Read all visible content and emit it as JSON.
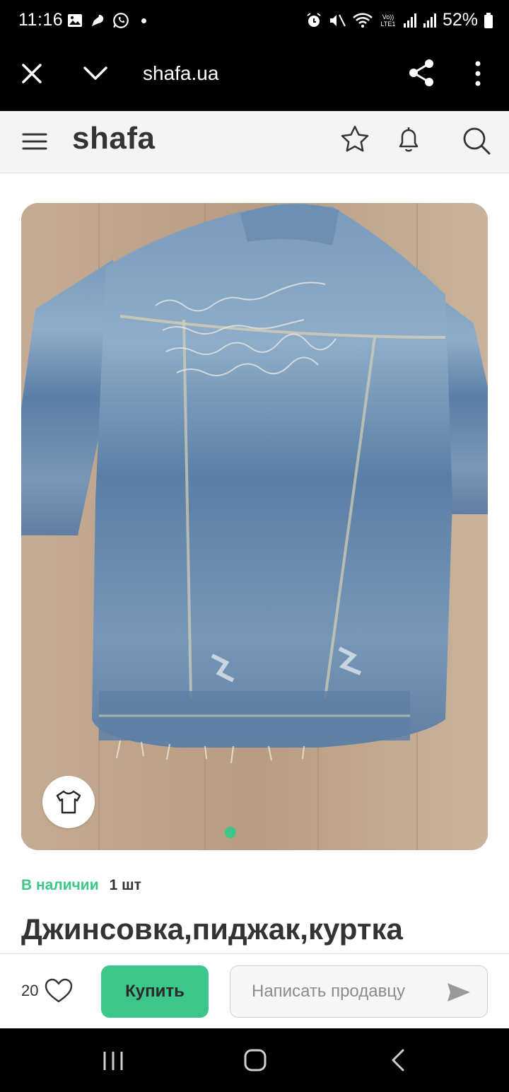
{
  "status_bar": {
    "time": "11:16",
    "battery_percent": "52%",
    "icons_left": [
      "gallery-icon",
      "messenger-icon",
      "whatsapp-icon",
      "notification-dot"
    ],
    "icons_right": [
      "alarm-icon",
      "mute-icon",
      "wifi-icon",
      "volte-icon",
      "signal-icon",
      "signal-icon",
      "battery-icon"
    ],
    "volte_label": "Vo)) LTE1"
  },
  "browser": {
    "url": "shafa.ua",
    "close_icon": "close-icon",
    "collapse_icon": "chevron-down-icon",
    "share_icon": "share-icon",
    "menu_icon": "more-vertical-icon"
  },
  "site_header": {
    "logo": "shafa",
    "icons": [
      "menu-icon",
      "star-icon",
      "bell-icon",
      "search-icon"
    ]
  },
  "gallery": {
    "image_count": 1,
    "active_index": 0,
    "size_chip_icon": "tshirt-icon",
    "accent_color": "#3cc68a"
  },
  "availability": {
    "status": "В наличии",
    "quantity": "1 шт"
  },
  "product": {
    "title": "Джинсовка,пиджак,куртка"
  },
  "actions": {
    "likes_count": "20",
    "buy_label": "Купить",
    "message_placeholder": "Написать продавцу",
    "buy_color": "#3cc68a"
  },
  "nav_bar": {
    "icons": [
      "recents-icon",
      "home-icon",
      "back-icon"
    ]
  }
}
